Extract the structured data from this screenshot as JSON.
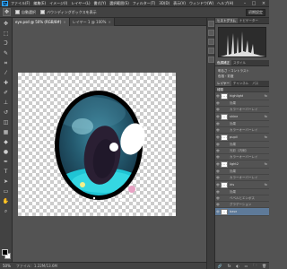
{
  "app": {
    "logo": "Ps"
  },
  "menubar": {
    "items": [
      "ファイル(F)",
      "編集(E)",
      "イメージ(I)",
      "レイヤー(L)",
      "書式(Y)",
      "選択範囲(S)",
      "フィルター(T)",
      "3D(D)",
      "表示(V)",
      "ウィンドウ(W)",
      "ヘルプ(H)"
    ],
    "minimize": "–",
    "maximize": "□",
    "close": "×"
  },
  "optionsbar": {
    "tool_icon": "✥",
    "auto_select_label": "自動選択",
    "transform_label": "バウンディングボックスを表示",
    "workspace": "初期設定"
  },
  "tabs": [
    {
      "label": "eye.psd @ 50% (RGB/8#)",
      "close": "×",
      "active": true
    },
    {
      "label": "レイヤー 1 @ 100%",
      "close": "×",
      "active": false
    }
  ],
  "statusbar": {
    "zoom": "50%",
    "docinfo": "ファイル：1.22M/13.6M"
  },
  "panels": {
    "top_tabs": [
      "ヒストグラム",
      "ナビゲーター"
    ],
    "mid_tabs": [
      "色調補正",
      "スタイル"
    ],
    "props": [
      "明るさ・コントラスト",
      "色相・彩度"
    ],
    "layer_tabs": [
      "レイヤー",
      "チャンネル",
      "パス"
    ],
    "layer_kind": "種類",
    "layers": [
      {
        "name": "highlight",
        "type": "layer",
        "fx": "fx"
      },
      {
        "name": "効果",
        "type": "sub"
      },
      {
        "name": "カラーオーバーレイ",
        "type": "sub"
      },
      {
        "name": "shine",
        "type": "layer",
        "fx": "fx"
      },
      {
        "name": "効果",
        "type": "sub"
      },
      {
        "name": "カラーオーバーレイ",
        "type": "sub"
      },
      {
        "name": "pupil",
        "type": "layer",
        "fx": "fx"
      },
      {
        "name": "効果",
        "type": "sub"
      },
      {
        "name": "光彩（内側）",
        "type": "sub"
      },
      {
        "name": "カラーオーバーレイ",
        "type": "sub"
      },
      {
        "name": "light2",
        "type": "layer",
        "fx": "fx"
      },
      {
        "name": "効果",
        "type": "sub"
      },
      {
        "name": "カラーオーバーレイ",
        "type": "sub"
      },
      {
        "name": "iris",
        "type": "layer",
        "fx": "fx"
      },
      {
        "name": "効果",
        "type": "sub"
      },
      {
        "name": "ベベルとエンボス",
        "type": "sub"
      },
      {
        "name": "グラデーション",
        "type": "sub"
      },
      {
        "name": "base",
        "type": "layer",
        "active": true
      }
    ],
    "bottom_icons": [
      "🔗",
      "fx",
      "◐",
      "▭",
      "🗀",
      "🗑"
    ]
  },
  "colors": {
    "outline": "#000000",
    "iris_dark": "#1d3f52",
    "iris_mid": "#2f6f86",
    "iris_cyan": "#22c9d6",
    "pupil": "#2a1f33",
    "highlight": "#ffffff",
    "pink": "#e8a2c4",
    "yellow": "#f3f08a"
  }
}
